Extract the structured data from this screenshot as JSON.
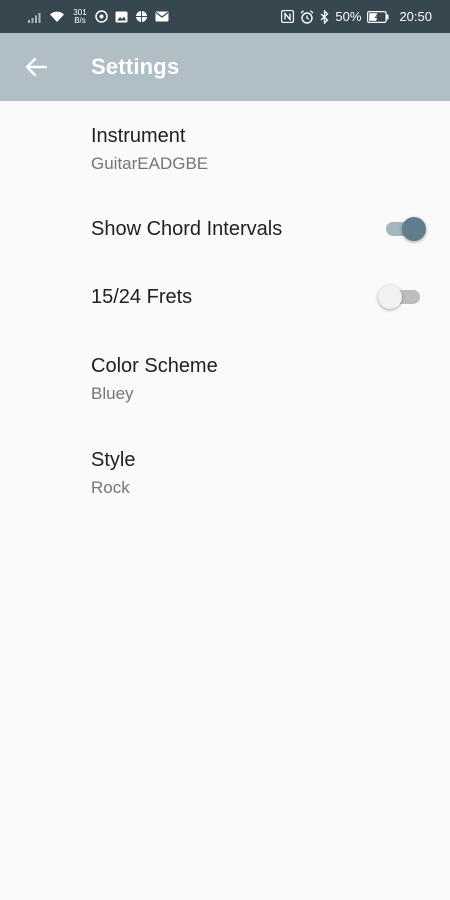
{
  "status_bar": {
    "net_speed_value": "301",
    "net_speed_unit": "B/s",
    "battery": "50%",
    "time": "20:50"
  },
  "app_bar": {
    "title": "Settings",
    "back_icon": "arrow-back-icon"
  },
  "settings": {
    "instrument": {
      "title": "Instrument",
      "summary": "GuitarEADGBE"
    },
    "chord_intervals": {
      "title": "Show Chord Intervals",
      "checked": true
    },
    "frets": {
      "title": "15/24 Frets",
      "checked": false
    },
    "color_scheme": {
      "title": "Color Scheme",
      "summary": "Bluey"
    },
    "style": {
      "title": "Style",
      "summary": "Rock"
    }
  },
  "colors": {
    "status_bar": "#37474f",
    "app_bar": "#b0bec5",
    "switch_on_thumb": "#607d8b",
    "background": "#fafafa"
  }
}
